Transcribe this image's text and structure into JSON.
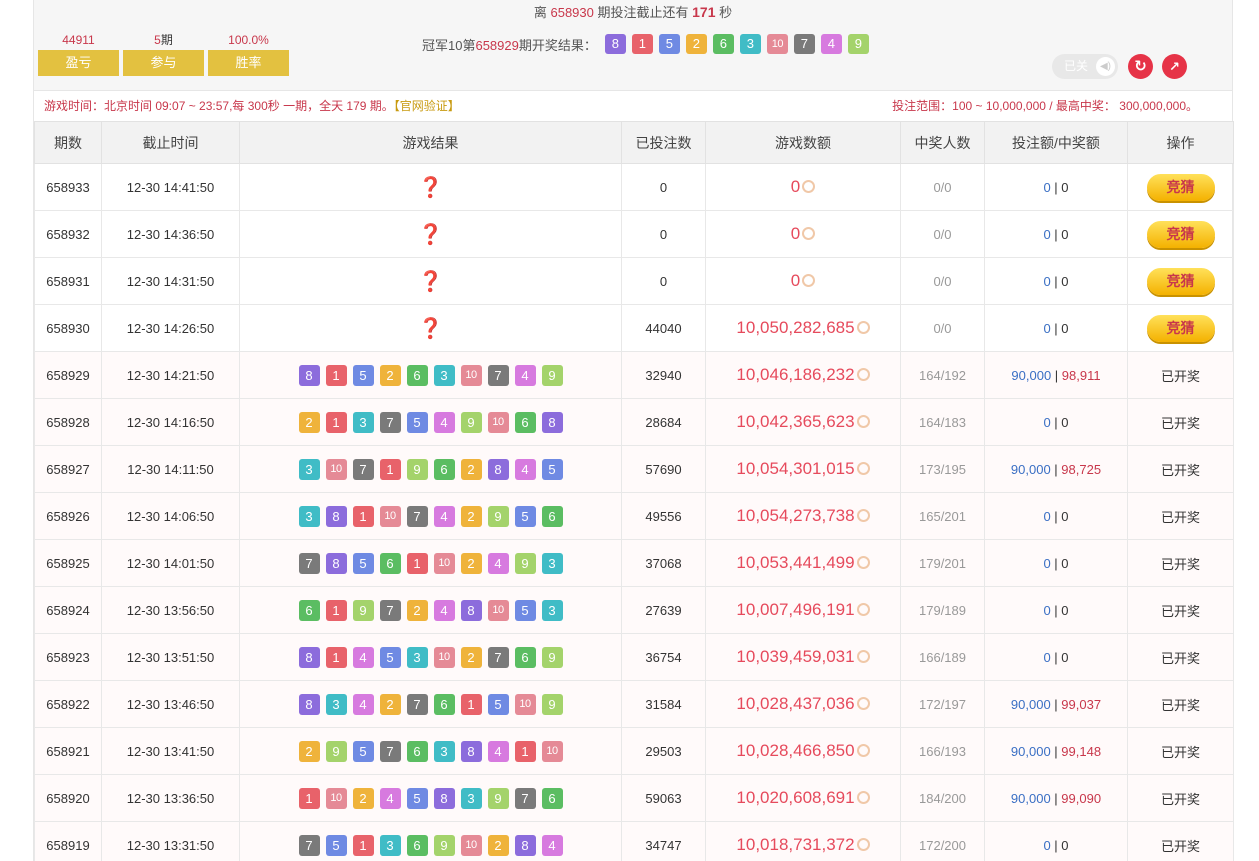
{
  "header": {
    "countdown_prefix": "离",
    "countdown_issue": "658930",
    "countdown_mid": "期投注截止还有",
    "countdown_secs": "171",
    "countdown_suffix": "秒",
    "stats": [
      {
        "value": "44911",
        "unit": "",
        "label": "盈亏"
      },
      {
        "value": "5",
        "unit": "期",
        "label": "参与"
      },
      {
        "value": "100.0%",
        "unit": "",
        "label": "胜率"
      }
    ],
    "last_result_prefix": "冠军10第",
    "last_result_issue": "658929",
    "last_result_suffix": "期开奖结果：",
    "last_result_balls": [
      8,
      1,
      5,
      2,
      6,
      3,
      10,
      7,
      4,
      9
    ],
    "toggle_label": "已关",
    "refresh_icon": "refresh-icon",
    "trend_icon": "trend-icon"
  },
  "info_bar": {
    "game_time": "游戏时间：北京时间 09:07 ~ 23:57,每 300秒 一期，全天 179 期。",
    "verify_link": "【官网验证】",
    "bet_range": "投注范围：100 ~ 10,000,000 / 最高中奖： 300,000,000。"
  },
  "ball_colors": {
    "1": "#e8626a",
    "2": "#efb33b",
    "3": "#40bcc6",
    "4": "#d77adf",
    "5": "#6f8ae3",
    "6": "#5bbd62",
    "7": "#7a7a7a",
    "8": "#8c6cdc",
    "9": "#a4d36b",
    "10": "#e58a96"
  },
  "table": {
    "headers": [
      "期数",
      "截止时间",
      "游戏结果",
      "已投注数",
      "游戏数额",
      "中奖人数",
      "投注额/中奖额",
      "操作"
    ],
    "pending_mark": "❓",
    "guess_label": "竞猜",
    "opened_label": "已开奖",
    "rows": [
      {
        "issue": "658933",
        "time": "12-30 14:41:50",
        "balls": [],
        "bets": "0",
        "amount": "0",
        "winners": "0/0",
        "bet_amt": "0",
        "win_amt": "0",
        "status": "guess"
      },
      {
        "issue": "658932",
        "time": "12-30 14:36:50",
        "balls": [],
        "bets": "0",
        "amount": "0",
        "winners": "0/0",
        "bet_amt": "0",
        "win_amt": "0",
        "status": "guess"
      },
      {
        "issue": "658931",
        "time": "12-30 14:31:50",
        "balls": [],
        "bets": "0",
        "amount": "0",
        "winners": "0/0",
        "bet_amt": "0",
        "win_amt": "0",
        "status": "guess"
      },
      {
        "issue": "658930",
        "time": "12-30 14:26:50",
        "balls": [],
        "bets": "44040",
        "amount": "10,050,282,685",
        "winners": "0/0",
        "bet_amt": "0",
        "win_amt": "0",
        "status": "guess"
      },
      {
        "issue": "658929",
        "time": "12-30 14:21:50",
        "balls": [
          8,
          1,
          5,
          2,
          6,
          3,
          10,
          7,
          4,
          9
        ],
        "bets": "32940",
        "amount": "10,046,186,232",
        "winners": "164/192",
        "bet_amt": "90,000",
        "win_amt": "98,911",
        "status": "opened"
      },
      {
        "issue": "658928",
        "time": "12-30 14:16:50",
        "balls": [
          2,
          1,
          3,
          7,
          5,
          4,
          9,
          10,
          6,
          8
        ],
        "bets": "28684",
        "amount": "10,042,365,623",
        "winners": "164/183",
        "bet_amt": "0",
        "win_amt": "0",
        "status": "opened"
      },
      {
        "issue": "658927",
        "time": "12-30 14:11:50",
        "balls": [
          3,
          10,
          7,
          1,
          9,
          6,
          2,
          8,
          4,
          5
        ],
        "bets": "57690",
        "amount": "10,054,301,015",
        "winners": "173/195",
        "bet_amt": "90,000",
        "win_amt": "98,725",
        "status": "opened"
      },
      {
        "issue": "658926",
        "time": "12-30 14:06:50",
        "balls": [
          3,
          8,
          1,
          10,
          7,
          4,
          2,
          9,
          5,
          6
        ],
        "bets": "49556",
        "amount": "10,054,273,738",
        "winners": "165/201",
        "bet_amt": "0",
        "win_amt": "0",
        "status": "opened"
      },
      {
        "issue": "658925",
        "time": "12-30 14:01:50",
        "balls": [
          7,
          8,
          5,
          6,
          1,
          10,
          2,
          4,
          9,
          3
        ],
        "bets": "37068",
        "amount": "10,053,441,499",
        "winners": "179/201",
        "bet_amt": "0",
        "win_amt": "0",
        "status": "opened"
      },
      {
        "issue": "658924",
        "time": "12-30 13:56:50",
        "balls": [
          6,
          1,
          9,
          7,
          2,
          4,
          8,
          10,
          5,
          3
        ],
        "bets": "27639",
        "amount": "10,007,496,191",
        "winners": "179/189",
        "bet_amt": "0",
        "win_amt": "0",
        "status": "opened"
      },
      {
        "issue": "658923",
        "time": "12-30 13:51:50",
        "balls": [
          8,
          1,
          4,
          5,
          3,
          10,
          2,
          7,
          6,
          9
        ],
        "bets": "36754",
        "amount": "10,039,459,031",
        "winners": "166/189",
        "bet_amt": "0",
        "win_amt": "0",
        "status": "opened"
      },
      {
        "issue": "658922",
        "time": "12-30 13:46:50",
        "balls": [
          8,
          3,
          4,
          2,
          7,
          6,
          1,
          5,
          10,
          9
        ],
        "bets": "31584",
        "amount": "10,028,437,036",
        "winners": "172/197",
        "bet_amt": "90,000",
        "win_amt": "99,037",
        "status": "opened"
      },
      {
        "issue": "658921",
        "time": "12-30 13:41:50",
        "balls": [
          2,
          9,
          5,
          7,
          6,
          3,
          8,
          4,
          1,
          10
        ],
        "bets": "29503",
        "amount": "10,028,466,850",
        "winners": "166/193",
        "bet_amt": "90,000",
        "win_amt": "99,148",
        "status": "opened"
      },
      {
        "issue": "658920",
        "time": "12-30 13:36:50",
        "balls": [
          1,
          10,
          2,
          4,
          5,
          8,
          3,
          9,
          7,
          6
        ],
        "bets": "59063",
        "amount": "10,020,608,691",
        "winners": "184/200",
        "bet_amt": "90,000",
        "win_amt": "99,090",
        "status": "opened"
      },
      {
        "issue": "658919",
        "time": "12-30 13:31:50",
        "balls": [
          7,
          5,
          1,
          3,
          6,
          9,
          10,
          2,
          8,
          4
        ],
        "bets": "34747",
        "amount": "10,018,731,372",
        "winners": "172/200",
        "bet_amt": "0",
        "win_amt": "0",
        "status": "opened"
      }
    ]
  }
}
